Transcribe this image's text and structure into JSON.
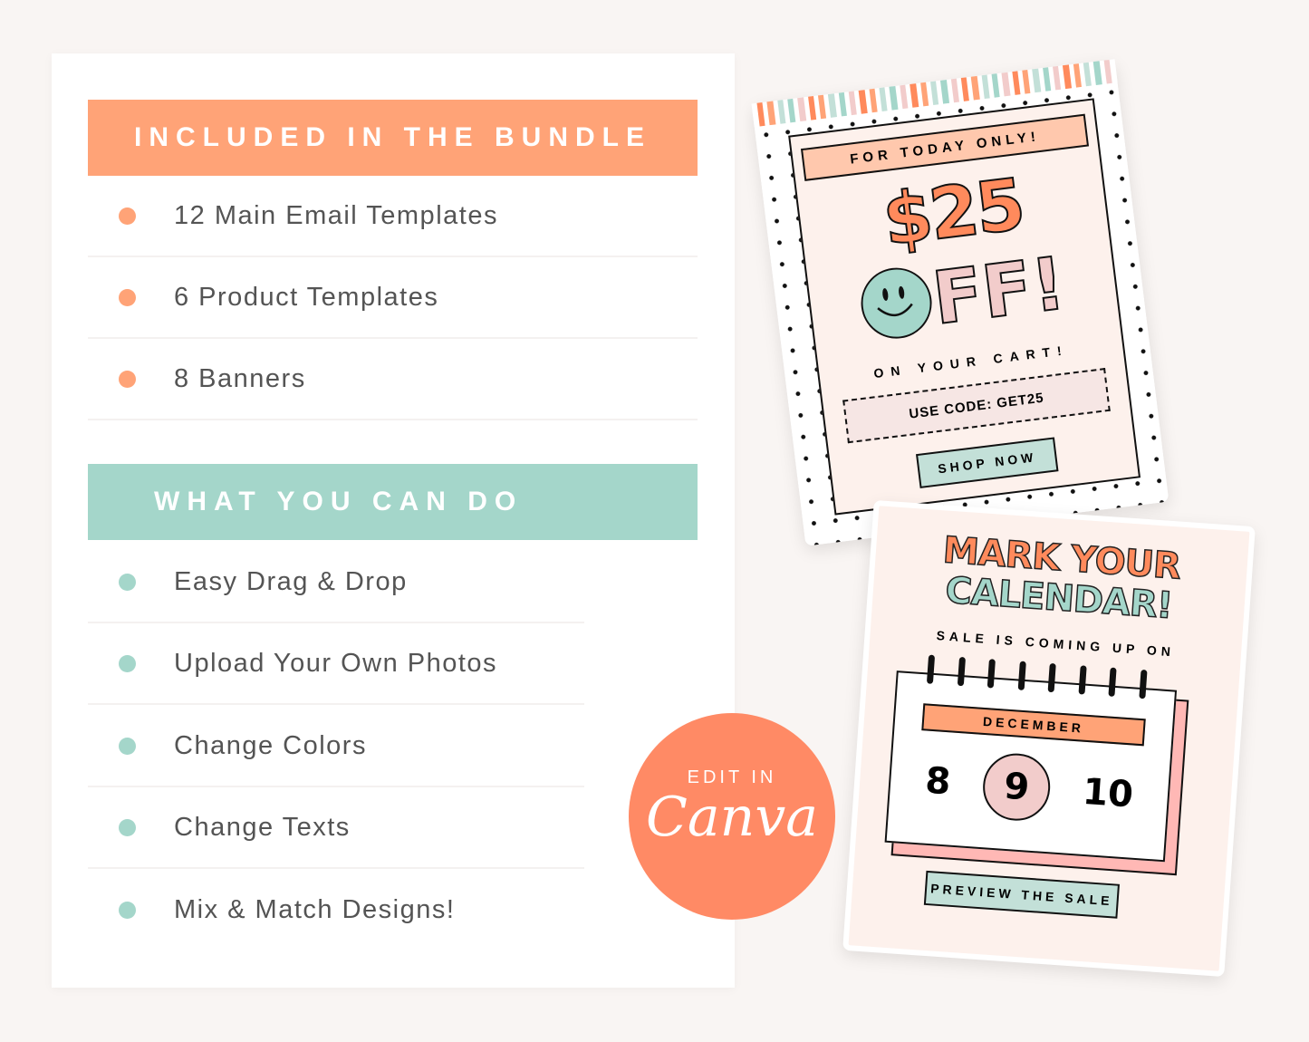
{
  "features_card": {
    "bundle_section": {
      "heading": "INCLUDED IN THE BUNDLE",
      "items": [
        "12 Main Email Templates",
        "6 Product Templates",
        "8 Banners"
      ]
    },
    "capabilities_section": {
      "heading": "WHAT YOU CAN DO",
      "items": [
        "Easy Drag & Drop",
        "Upload Your Own Photos",
        "Change Colors",
        "Change Texts",
        "Mix & Match Designs!"
      ]
    }
  },
  "promo_poster": {
    "tagline": "FOR TODAY ONLY!",
    "amount": "$25",
    "off": "FF!",
    "subline": "ON YOUR CART!",
    "code": "USE CODE: GET25",
    "button": "SHOP NOW"
  },
  "calendar_poster": {
    "title_line1": "MARK YOUR",
    "title_line2": "CALENDAR!",
    "subtitle": "SALE IS COMING UP ON",
    "month": "DECEMBER",
    "days": [
      "8",
      "9",
      "10"
    ],
    "highlighted_day": "9",
    "button": "PREVIEW THE SALE"
  },
  "canva_badge": {
    "label": "EDIT IN",
    "brand": "Canva"
  },
  "colors": {
    "orange": "#ffa377",
    "teal": "#a4d6ca",
    "coral": "#ff8a65",
    "pink": "#f2cccb",
    "cream": "#fdf1ec"
  }
}
